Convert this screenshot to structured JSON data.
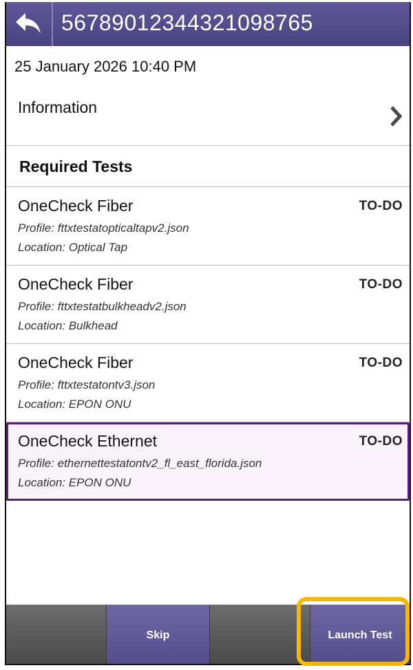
{
  "header": {
    "title": "5678901234432109876​5",
    "back_icon": "back-arrow-icon"
  },
  "date": "25 January 2026 10:40 PM",
  "information": {
    "label": "Information",
    "icon": "chevron-right-icon"
  },
  "required_tests": {
    "title": "Required Tests",
    "items": [
      {
        "name": "OneCheck Fiber",
        "status": "TO-DO",
        "profile": "Profile: fttxtestatopticaltapv2.json",
        "location": "Location: Optical Tap"
      },
      {
        "name": "OneCheck Fiber",
        "status": "TO-DO",
        "profile": "Profile: fttxtestatbulkheadv2.json",
        "location": "Location: Bulkhead"
      },
      {
        "name": "OneCheck Fiber",
        "status": "TO-DO",
        "profile": "Profile: fttxtestatontv3.json",
        "location": "Location: EPON ONU"
      },
      {
        "name": "OneCheck Ethernet",
        "status": "TO-DO",
        "profile": "Profile: ethernettestatontv2_fl_east_florida.json",
        "location": "Location: EPON ONU",
        "selected": true
      }
    ]
  },
  "footer": {
    "skip_label": "Skip",
    "launch_label": "Launch Test"
  },
  "colors": {
    "header": "#544d8c",
    "selection_border": "#5b1f73",
    "highlight": "#f6b800"
  }
}
